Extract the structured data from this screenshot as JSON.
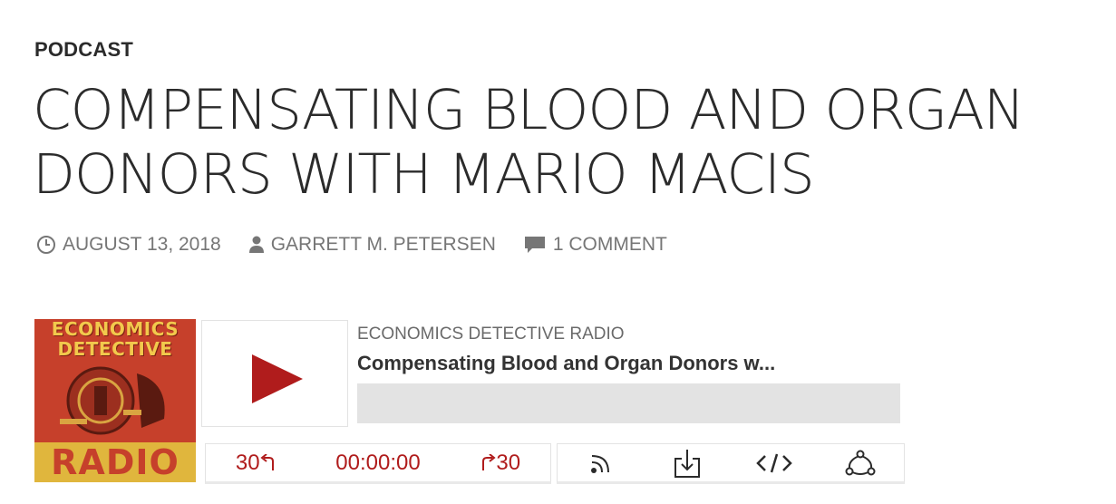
{
  "post": {
    "category": "PODCAST",
    "title": "COMPENSATING BLOOD AND ORGAN DONORS WITH MARIO MACIS",
    "date": "AUGUST 13, 2018",
    "author": "GARRETT M. PETERSEN",
    "comments": "1 COMMENT"
  },
  "player": {
    "cover": {
      "line1": "ECONOMICS",
      "line2": "DETECTIVE",
      "line3": "RADIO"
    },
    "show_name": "ECONOMICS DETECTIVE RADIO",
    "episode_title": "Compensating Blood and Organ Donors w...",
    "progress": 0,
    "rewind_label": "30",
    "time": "00:00:00",
    "forward_label": "30",
    "icons": [
      "rss-icon",
      "download-icon",
      "embed-icon",
      "share-icon"
    ]
  },
  "colors": {
    "accent": "#b01c1c",
    "meta": "#767676",
    "progress_track": "#e3e3e3",
    "cover_red": "#c6402b",
    "cover_gold": "#e0b63d"
  }
}
